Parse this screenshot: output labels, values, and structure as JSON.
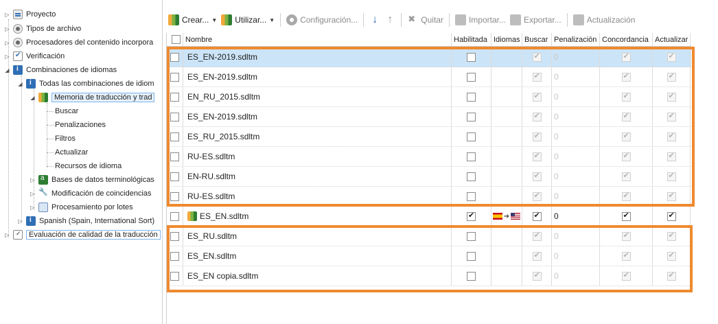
{
  "tree": {
    "nodes": [
      {
        "label": "Proyecto"
      },
      {
        "label": "Tipos de archivo"
      },
      {
        "label": "Procesadores del contenido incorpora"
      },
      {
        "label": "Verificación"
      },
      {
        "label": "Combinaciones de idiomas"
      },
      {
        "label": "Todas las combinaciones de idiom"
      },
      {
        "label": "Memoria de traducción y trad"
      },
      {
        "label": "Buscar"
      },
      {
        "label": "Penalizaciones"
      },
      {
        "label": "Filtros"
      },
      {
        "label": "Actualizar"
      },
      {
        "label": "Recursos de idioma"
      },
      {
        "label": "Bases de datos terminológicas"
      },
      {
        "label": "Modificación de coincidencias"
      },
      {
        "label": "Procesamiento por lotes"
      },
      {
        "label": "Spanish (Spain, International Sort)"
      },
      {
        "label": "Evaluación de calidad de la traducción"
      }
    ]
  },
  "toolbar": {
    "crear": "Crear...",
    "utilizar": "Utilizar...",
    "configuracion": "Configuración...",
    "quitar": "Quitar",
    "importar": "Importar...",
    "exportar": "Exportar...",
    "actualizacion": "Actualización"
  },
  "grid": {
    "headers": {
      "nombre": "Nombre",
      "habilitada": "Habilitada",
      "idiomas": "Idiomas",
      "buscar": "Buscar",
      "penalizacion": "Penalización",
      "concordancia": "Concordancia",
      "actualizar": "Actualizar"
    },
    "rows": [
      {
        "name": "ES_EN-2019.sdltm",
        "enabled": false,
        "penalty": "0"
      },
      {
        "name": "ES_EN-2019.sdltm",
        "enabled": false,
        "penalty": "0"
      },
      {
        "name": "EN_RU_2015.sdltm",
        "enabled": false,
        "penalty": "0"
      },
      {
        "name": "ES_EN-2019.sdltm",
        "enabled": false,
        "penalty": "0"
      },
      {
        "name": "ES_RU_2015.sdltm",
        "enabled": false,
        "penalty": "0"
      },
      {
        "name": "RU-ES.sdltm",
        "enabled": false,
        "penalty": "0"
      },
      {
        "name": "EN-RU.sdltm",
        "enabled": false,
        "penalty": "0"
      },
      {
        "name": "RU-ES.sdltm",
        "enabled": false,
        "penalty": "0"
      },
      {
        "name": "ES_EN.sdltm",
        "enabled": true,
        "penalty": "0"
      },
      {
        "name": "ES_RU.sdltm",
        "enabled": false,
        "penalty": "0"
      },
      {
        "name": "ES_EN.sdltm",
        "enabled": false,
        "penalty": "0"
      },
      {
        "name": "ES_EN copia.sdltm",
        "enabled": false,
        "penalty": "0"
      }
    ]
  },
  "colors": {
    "annotation": "#ef8a2f",
    "selection": "#cce4f7",
    "accent": "#2f6fb5"
  }
}
